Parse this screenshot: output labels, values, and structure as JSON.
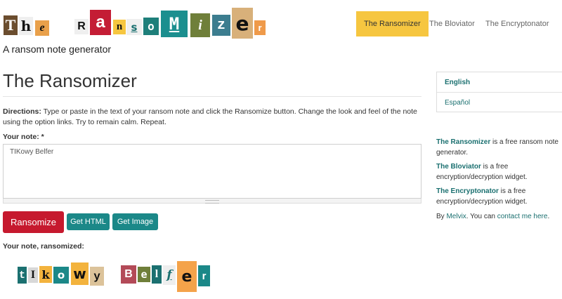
{
  "logo": {
    "title": "The Ransomizer"
  },
  "header": {
    "tagline": "A ransom note generator",
    "nav": [
      "The Ransomizer",
      "The Bloviator",
      "The Encryptonator"
    ]
  },
  "main": {
    "page_title": "The Ransomizer",
    "directions_label": "Directions:",
    "directions_text": " Type or paste in the text of your ransom note and click the Ransomize button. Change the look and feel of the note using the option links. Try to remain calm. Repeat.",
    "note_label": "Your note: *",
    "note_value": "TIKowy Belfer",
    "buttons": {
      "ransomize": "Ransomize",
      "get_html": "Get HTML",
      "get_image": "Get Image"
    },
    "output_label": "Your note, ransomized:",
    "output_text": "tIkowy Belfer"
  },
  "sidebar": {
    "languages": [
      "English",
      "Español"
    ],
    "blurbs": [
      {
        "name": "The Ransomizer",
        "text": " is a free ransom note generator."
      },
      {
        "name": "The Bloviator",
        "text": " is a free encryption/decryption widget."
      },
      {
        "name": "The Encryptonator",
        "text": " is a free encryption/decryption widget."
      }
    ],
    "credit_by": "By ",
    "credit_name": "Melvix",
    "credit_mid": ". You can ",
    "credit_link": "contact me here",
    "credit_end": "."
  },
  "colors": {
    "accent_yellow": "#f6c640",
    "button_red": "#c6192e",
    "button_teal": "#1b8888",
    "link_teal": "#1b7070"
  }
}
